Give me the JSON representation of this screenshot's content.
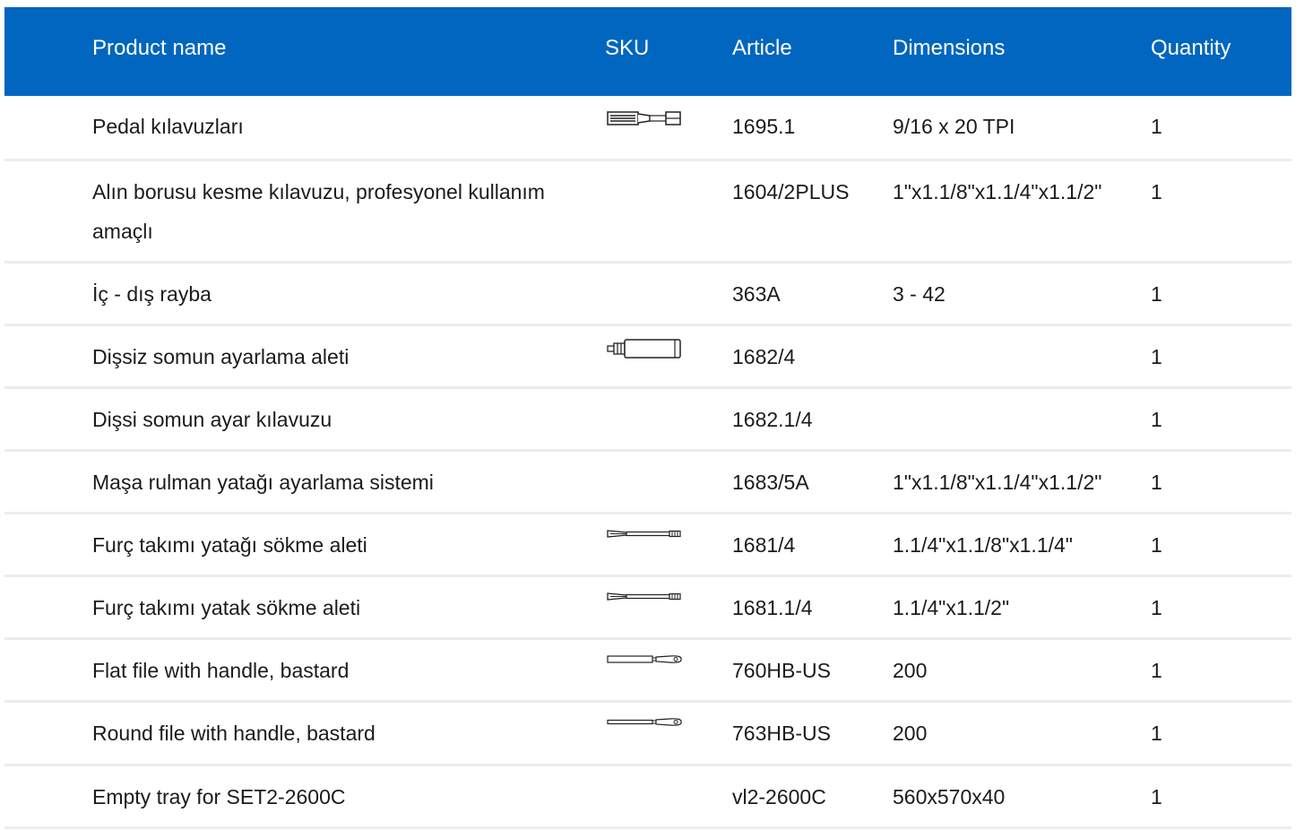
{
  "header": {
    "product_name": "Product name",
    "sku": "SKU",
    "article": "Article",
    "dimensions": "Dimensions",
    "quantity": "Quantity"
  },
  "colors": {
    "header_bg": "#0066bf",
    "header_text": "#ffffff",
    "row_divider": "#ececec"
  },
  "rows": [
    {
      "name": "Pedal kılavuzları",
      "sku_icon": "tap-tool-icon",
      "article": "1695.1",
      "dimensions": "9/16 x 20 TPI",
      "quantity": "1"
    },
    {
      "name": "Alın borusu kesme kılavuzu, profesyonel kullanım amaçlı",
      "sku_icon": "",
      "article": "1604/2PLUS",
      "dimensions": "1\"x1.1/8\"x1.1/4\"x1.1/2\"",
      "quantity": "1"
    },
    {
      "name": "İç - dış rayba",
      "sku_icon": "",
      "article": "363A",
      "dimensions": "3 - 42",
      "quantity": "1"
    },
    {
      "name": "Dişsiz somun ayarlama aleti",
      "sku_icon": "adjuster-tool-icon",
      "article": "1682/4",
      "dimensions": "",
      "quantity": "1"
    },
    {
      "name": "Dişsi somun ayar kılavuzu",
      "sku_icon": "",
      "article": "1682.1/4",
      "dimensions": "",
      "quantity": "1"
    },
    {
      "name": "Maşa rulman yatağı ayarlama sistemi",
      "sku_icon": "",
      "article": "1683/5A",
      "dimensions": "1\"x1.1/8\"x1.1/4\"x1.1/2\"",
      "quantity": "1"
    },
    {
      "name": "Furç takımı yatağı sökme aleti",
      "sku_icon": "remover-tool-icon",
      "article": "1681/4",
      "dimensions": "1.1/4\"x1.1/8\"x1.1/4\"",
      "quantity": "1"
    },
    {
      "name": "Furç takımı yatak sökme aleti",
      "sku_icon": "remover-tool-icon",
      "article": "1681.1/4",
      "dimensions": "1.1/4\"x1.1/2\"",
      "quantity": "1"
    },
    {
      "name": "Flat file with handle, bastard",
      "sku_icon": "flat-file-icon",
      "article": "760HB-US",
      "dimensions": "200",
      "quantity": "1"
    },
    {
      "name": "Round file with handle, bastard",
      "sku_icon": "round-file-icon",
      "article": "763HB-US",
      "dimensions": "200",
      "quantity": "1"
    },
    {
      "name": "Empty tray for SET2-2600C",
      "sku_icon": "",
      "article": "vl2-2600C",
      "dimensions": "560x570x40",
      "quantity": "1"
    }
  ]
}
